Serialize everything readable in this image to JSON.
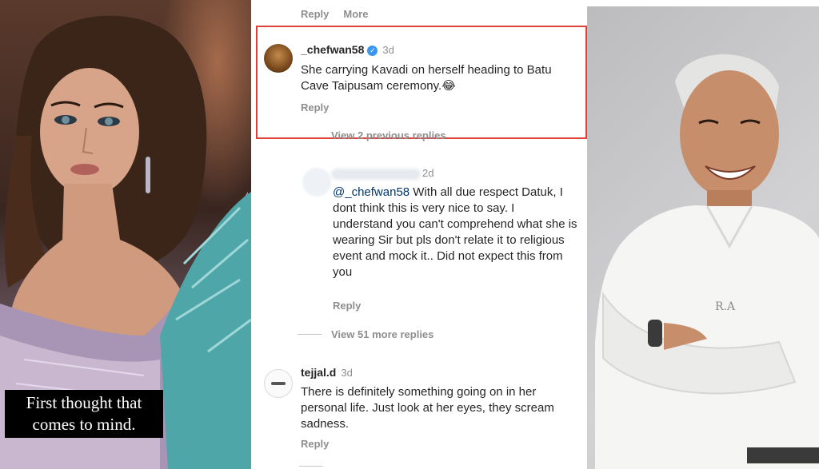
{
  "left_panel": {
    "caption_line1": "First thought that",
    "caption_line2": "comes to mind."
  },
  "comments_panel": {
    "top_actions": {
      "reply": "Reply",
      "more": "More"
    },
    "highlighted_comment": {
      "username": "_chefwan58",
      "verified": true,
      "time": "3d",
      "text": "She carrying Kavadi on herself heading to Batu Cave Taipusam ceremony.😂",
      "reply_label": "Reply",
      "view_previous": "View 2 previous replies"
    },
    "reply_comment": {
      "time": "2d",
      "mention": "@_chefwan58",
      "text": " With all due respect Datuk, I dont think this is very nice to say. I understand you can't comprehend what she is wearing Sir but pls don't relate it to religious event and mock it.. Did not expect this from you",
      "reply_label": "Reply",
      "more_replies": "View 51 more replies"
    },
    "third_comment": {
      "username": "tejjal.d",
      "time": "3d",
      "text": "There is definitely something going on in her personal life. Just look at her eyes, they scream sadness.",
      "reply_label": "Reply"
    }
  },
  "colors": {
    "highlight_border": "#e0403a",
    "mention": "#00376b",
    "meta_grey": "#8e8e8e",
    "verified_blue": "#3897f0"
  }
}
